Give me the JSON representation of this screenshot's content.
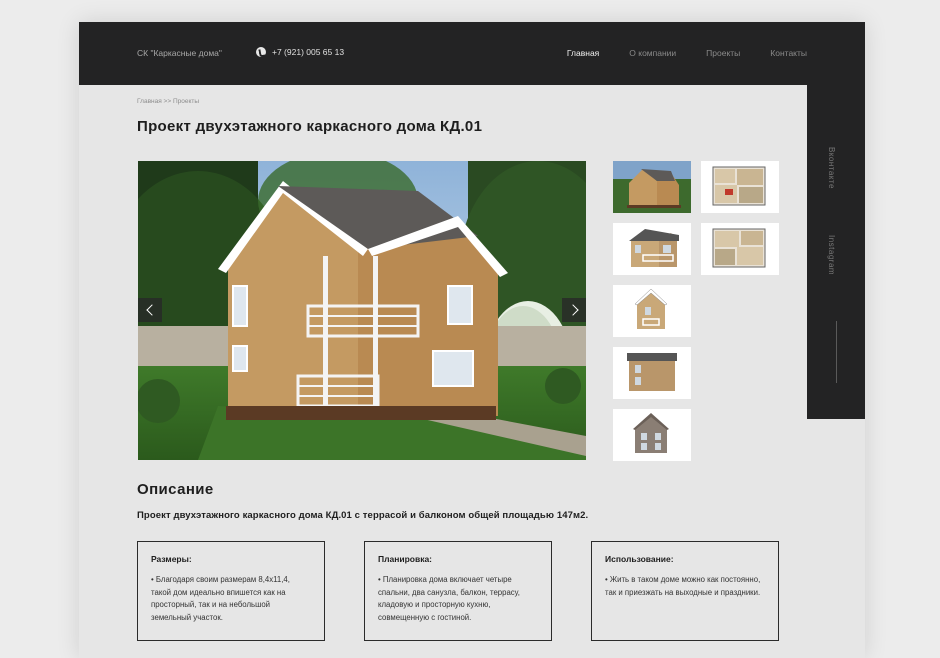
{
  "header": {
    "brand": "СК \"Каркасные дома\"",
    "phone": "+7 (921) 005 65 13",
    "nav": [
      {
        "label": "Главная",
        "active": true
      },
      {
        "label": "О компании",
        "active": false
      },
      {
        "label": "Проекты",
        "active": false
      },
      {
        "label": "Контакты",
        "active": false
      }
    ]
  },
  "social": {
    "vk": "Вконтакте",
    "instagram": "Instagram"
  },
  "breadcrumb": "Главная >> Проекты",
  "page_title": "Проект двухэтажного каркасного дома КД.01",
  "gallery": {
    "thumbnails": [
      "house-render-thumb",
      "floor-plan-1-thumb",
      "facade-front-thumb",
      "floor-plan-2-thumb",
      "facade-side-thumb",
      "facade-back-thumb",
      "facade-side-2-thumb"
    ]
  },
  "description": {
    "heading": "Описание",
    "lead": "Проект двухэтажного каркасного дома КД.01 с террасой и балконом общей площадью 147м2.",
    "cards": [
      {
        "title": "Размеры:",
        "text": "• Благодаря своим размерам 8,4х11,4, такой дом идеально впишется как на просторный, так и на небольшой земельный участок."
      },
      {
        "title": "Планировка:",
        "text": "• Планировка дома включает четыре спальни, два санузла, балкон, террасу, кладовую и просторную кухню, совмещенную с гостиной."
      },
      {
        "title": "Использование:",
        "text": "• Жить в таком доме можно как постоянно, так и приезжать на выходные и праздники."
      }
    ]
  },
  "colors": {
    "dark": "#232324",
    "background": "#e6e6e6",
    "text": "#1e1e1e"
  }
}
